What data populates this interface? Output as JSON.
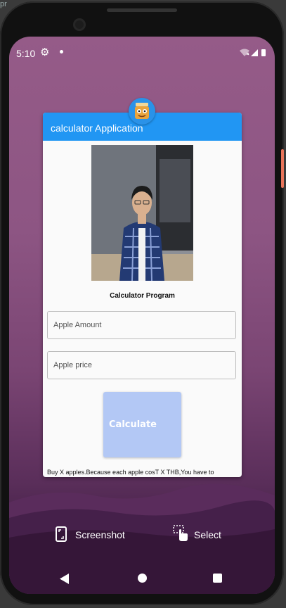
{
  "status": {
    "time": "5:10"
  },
  "app": {
    "title": "calculator Application",
    "program_title": "Calculator Program",
    "fields": {
      "amount_placeholder": "Apple Amount",
      "price_placeholder": "Apple price"
    },
    "calculate_label": "Calculate",
    "message": "Buy X apples.Because each apple cosT X THB,You have to"
  },
  "capture_bar": {
    "screenshot_label": "Screenshot",
    "select_label": "Select"
  },
  "colors": {
    "app_bar": "#2196f3",
    "calculate_button": "#b3c8f5",
    "wallpaper_top": "#955b88",
    "wallpaper_bottom": "#2c1231"
  },
  "icons": {
    "status": [
      "settings-icon",
      "notification-dot-icon",
      "wifi-icon",
      "signal-icon",
      "battery-icon"
    ],
    "capture": [
      "screenshot-icon",
      "select-icon"
    ],
    "nav": [
      "back-icon",
      "home-icon",
      "recents-icon"
    ]
  }
}
